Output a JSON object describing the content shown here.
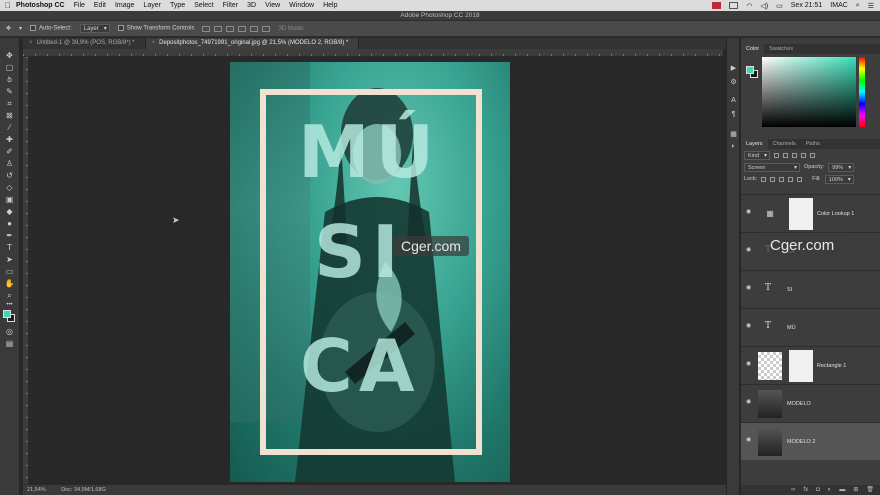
{
  "menubar": {
    "apple": "",
    "app": "Photoshop CC",
    "items": [
      "File",
      "Edit",
      "Image",
      "Layer",
      "Type",
      "Select",
      "Filter",
      "3D",
      "View",
      "Window",
      "Help"
    ],
    "clock": "Sex 21:51",
    "user": "IMAC"
  },
  "window": {
    "title": "Adobe Photoshop CC 2018"
  },
  "options": {
    "auto_select_label": "Auto-Select:",
    "auto_select_target": "Layer",
    "transform_label": "Show Transform Controls",
    "mode_3d": "3D Mode:"
  },
  "tabs": [
    {
      "label": "Untitled-1 @ 39,9% (POS, RGB/8*) *"
    },
    {
      "label": "Depositphotos_74971991_original.jpg @ 21,5% (MODELO 2, RGB/8) *"
    }
  ],
  "canvas": {
    "letters": [
      "MÚ",
      "SI",
      "CA"
    ],
    "watermark": "Cger.com",
    "accent": "#3fd6b8",
    "frame_color": "#f0e2d2"
  },
  "status": {
    "zoom": "21,54%",
    "doc": "Doc: 34,9M/1,68G"
  },
  "color_panel": {
    "tabs": [
      "Color",
      "Swatches"
    ],
    "fg_color": "#3fd6b8"
  },
  "layers_panel": {
    "tabs": [
      "Layers",
      "Channels",
      "Paths"
    ],
    "filter": "Kind",
    "blend_mode": "Screen",
    "opacity_label": "Opacity:",
    "opacity": "99%",
    "lock_label": "Lock:",
    "fill_label": "Fill:",
    "fill": "100%",
    "layers": [
      {
        "name": "Color Lookup 1",
        "kind": "adjustment"
      },
      {
        "name": "CA",
        "kind": "text"
      },
      {
        "name": "SI",
        "kind": "text"
      },
      {
        "name": "MÚ",
        "kind": "text"
      },
      {
        "name": "Rectangle 1",
        "kind": "shape"
      },
      {
        "name": "MODELO",
        "kind": "photo"
      },
      {
        "name": "MODELO 2",
        "kind": "photo",
        "active": true
      }
    ],
    "footer_icons": [
      "link-icon",
      "fx-icon",
      "mask-icon",
      "adjustment-icon",
      "folder-icon",
      "new-layer-icon",
      "trash-icon"
    ]
  },
  "watermark_right": "Cger.com"
}
